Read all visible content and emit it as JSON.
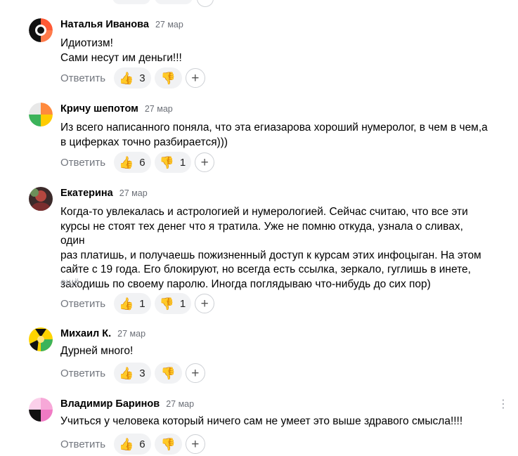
{
  "comments": [
    {
      "author": "Наталья Иванова",
      "date": "27 мар",
      "lines": [
        "Идиотизм!",
        "Сами несут им деньги!!!"
      ],
      "more": "",
      "reply_label": "Ответить",
      "likes": "3",
      "dislikes": "",
      "avatar_colors": [
        "#111111",
        "#ff5a36",
        "#ff7a4a",
        "#ffffff"
      ]
    },
    {
      "author": "Кричу шепотом",
      "date": "27 мар",
      "lines": [
        "Из всего написанного поняла, что эта егиазарова хороший нумеролог, в чем в чем,а",
        "в циферках точно разбирается)))"
      ],
      "more": "",
      "reply_label": "Ответить",
      "likes": "6",
      "dislikes": "1",
      "avatar_colors": [
        "#ff8a3d",
        "#ffcc00",
        "#3cb35a",
        "#e8e8e8"
      ]
    },
    {
      "author": "Екатерина",
      "date": "27 мар",
      "lines": [
        "Когда-то увлекалась и астрологией и нумерологией. Сейчас считаю, что все эти",
        "курсы не стоят тех денег что я тратила. Уже не помню откуда, узнала о сливах, один",
        "раз платишь, и получаешь пожизненный доступ к курсам этих инфоцыган. На этом",
        "сайте с 19 года. Его блокируют, но всегда есть ссылка, зеркало, гуглишь в инете,",
        "заходишь по своему паролю. Иногда поглядываю что-нибудь до сих пор)"
      ],
      "more": "ещё",
      "reply_label": "Ответить",
      "likes": "1",
      "dislikes": "1",
      "avatar_colors": [
        "#7a2e2e",
        "#b5473f",
        "#6d8f5a",
        "#3c2a2a"
      ]
    },
    {
      "author": "Михаил К.",
      "date": "27 мар",
      "lines": [
        "Дурней много!"
      ],
      "more": "",
      "reply_label": "Ответить",
      "likes": "3",
      "dislikes": "",
      "avatar_colors": [
        "#ffd400",
        "#111111",
        "#3cb35a",
        "#ffe680"
      ]
    },
    {
      "author": "Владимир Баринов",
      "date": "27 мар",
      "lines": [
        "Учиться у человека который ничего сам не умеет это выше здравого смысла!!!!"
      ],
      "more": "",
      "reply_label": "Ответить",
      "likes": "6",
      "dislikes": "",
      "avatar_colors": [
        "#f7a8d8",
        "#f07ac4",
        "#111111",
        "#fbd0ea"
      ]
    }
  ],
  "icons": {
    "like": "👍",
    "dislike": "👎",
    "add": "+",
    "menu": "⋮"
  }
}
